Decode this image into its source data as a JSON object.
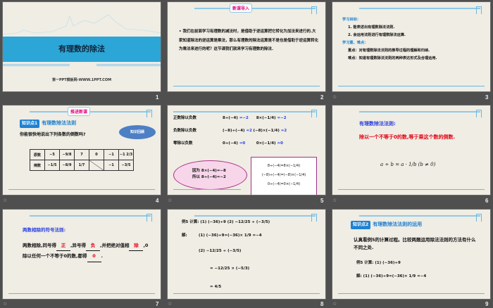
{
  "slides": [
    {
      "number": "1",
      "title": "有理数的除法",
      "subtitle": "第一PPT模板网-WWW.1PPT.COM"
    },
    {
      "number": "2",
      "tag": "新课导入",
      "bullet": "我们在前面学习有理数的减法时，是借助于逆运算把它转化为加法来进行的.大家知道除法的逆运算是乘法，那么有理数的除法运算是不是也是借助于逆运算转化为乘法来进行的呢？这节课我们就来学习有理数的除法."
    },
    {
      "number": "3",
      "goal_title": "学习目标：",
      "goals": [
        "1. 能表述出有理数除法法则.",
        "2. 会运用法则进行有理数除法运算."
      ],
      "key_title": "学习重、难点：",
      "key": "重点：对有理数除法法则的推导过程的理解和归纳.",
      "difficult": "难点：知道有理数除法法则的两种表达形式及合理运用."
    },
    {
      "number": "4",
      "tag": "推进新课",
      "point_tag": "知识点1",
      "point_title": "有理数除法法则",
      "question": "你能很快地说出下列各数的倒数吗?",
      "cloud": "知识回顾",
      "row1": [
        "原数",
        "−5",
        "−9/8",
        "7",
        "0",
        "−1",
        "−1 2/3"
      ],
      "row2": [
        "倒数",
        "−1/5",
        "−8/9",
        "1/7",
        "",
        "−1",
        "−3/5"
      ]
    },
    {
      "number": "5",
      "lines": [
        {
          "label": "正数除以负数",
          "div": "8÷(−4)",
          "res": "=−2",
          "mul": "8×(−1/4)",
          "res2": "=−2"
        },
        {
          "label": "负数除以负数",
          "div": "(−8)÷(−4)",
          "res": "=2",
          "mul": "(−8)×(−1/4)",
          "res2": "=2"
        },
        {
          "label": "零除以负数",
          "div": "0÷(−4)",
          "res": "=0",
          "mul": "0×(−1/4)",
          "res2": "=0"
        }
      ],
      "cloud_text": [
        "因为 8×(−4)=−8",
        "所以 8÷(−4)=−2"
      ],
      "box": [
        "8÷(−4)=8×(−1/4)",
        "(−8)÷(−4)=(−8)×(−1/4)",
        "0÷(−4)=0×(−1/4)"
      ]
    },
    {
      "number": "6",
      "title": "有理数除法法则:",
      "rule": "除以一个不等于0的数,等于乘这个数的倒数.",
      "formula": "a ÷ b = a · 1/b (b ≠ 0)"
    },
    {
      "number": "7",
      "title": "两数相除的符号法则:",
      "p1": "两数相除,同号得",
      "a1": "正",
      "p2": ",异号得",
      "a2": "负",
      "p3": ",并把绝对值相",
      "a3": "除",
      "p4": ",0除以任何一个不等于0的数,都得",
      "a4": "0",
      "p5": "."
    },
    {
      "number": "8",
      "example": "例5  计算:  (1) (−36)÷9   (2) −12/25 ÷ (−3/5)",
      "sol_label": "解:",
      "sol1": "(1) (−36)÷9=(−36)× 1/9 =−4",
      "sol2a": "(2) −12/25 ÷ (−3/5)",
      "sol2b": "= −12/25 × (−5/3)",
      "sol2c": "= 4/5"
    },
    {
      "number": "9",
      "point_tag": "知识点2",
      "point_title": "有理数除法法则的运用",
      "text": "认真看例5的计算过程。比较两题运用除法法则的方法有什么不同之处.",
      "example": "例5  计算:  (1) (−36)÷9",
      "solution": "解:   (1) (−36)÷9=(−36)× 1/9 =−4"
    }
  ],
  "anim_icon": "☆"
}
